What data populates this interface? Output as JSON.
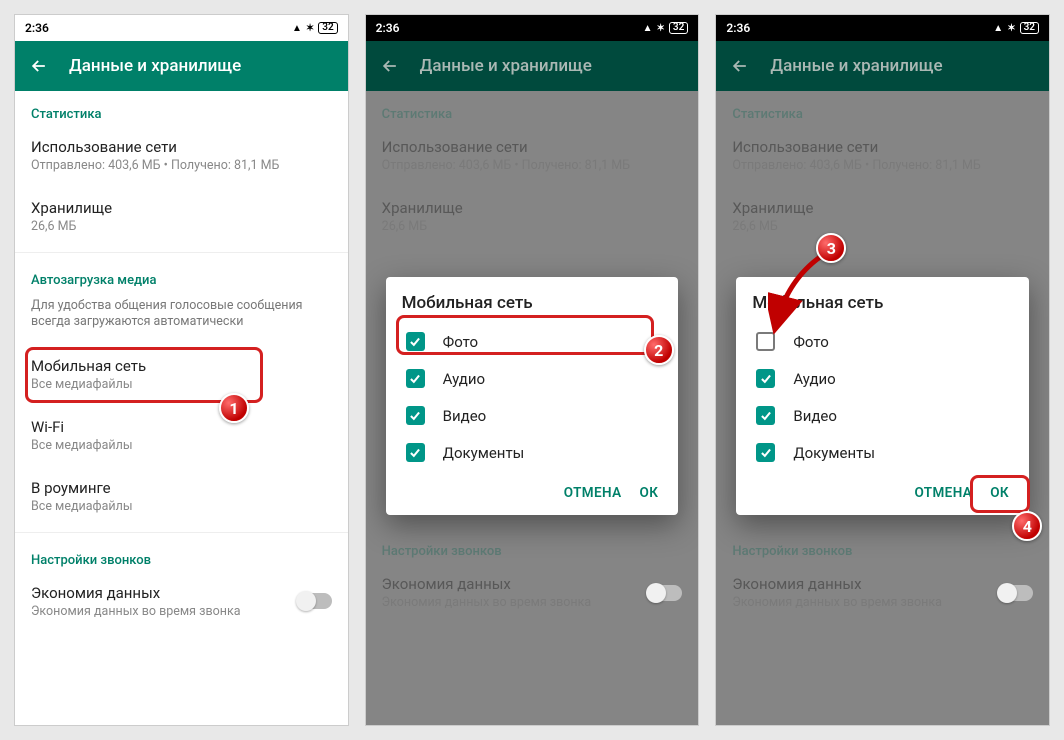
{
  "status": {
    "time": "2:36",
    "battery": "32"
  },
  "appbar": {
    "title": "Данные и хранилище"
  },
  "sections": {
    "stats_header": "Статистика",
    "net_usage_title": "Использование сети",
    "net_usage_sub": "Отправлено: 403,6 МБ • Получено: 81,1 МБ",
    "storage_title": "Хранилище",
    "storage_sub": "26,6 МБ",
    "autodl_header": "Автозагрузка медиа",
    "autodl_desc": "Для удобства общения голосовые сообщения всегда загружаются автоматически",
    "mobile_title": "Мобильная сеть",
    "mobile_sub": "Все медиафайлы",
    "wifi_title": "Wi-Fi",
    "wifi_sub": "Все медиафайлы",
    "roaming_title": "В роуминге",
    "roaming_sub": "Все медиафайлы",
    "calls_header": "Настройки звонков",
    "datasave_title": "Экономия данных",
    "datasave_sub": "Экономия данных во время звонка"
  },
  "dialog": {
    "title": "Мобильная сеть",
    "options": {
      "photo": "Фото",
      "audio": "Аудио",
      "video": "Видео",
      "docs": "Документы"
    },
    "cancel": "ОТМЕНА",
    "ok": "ОК"
  },
  "callouts": {
    "1": "1",
    "2": "2",
    "3": "3",
    "4": "4"
  }
}
